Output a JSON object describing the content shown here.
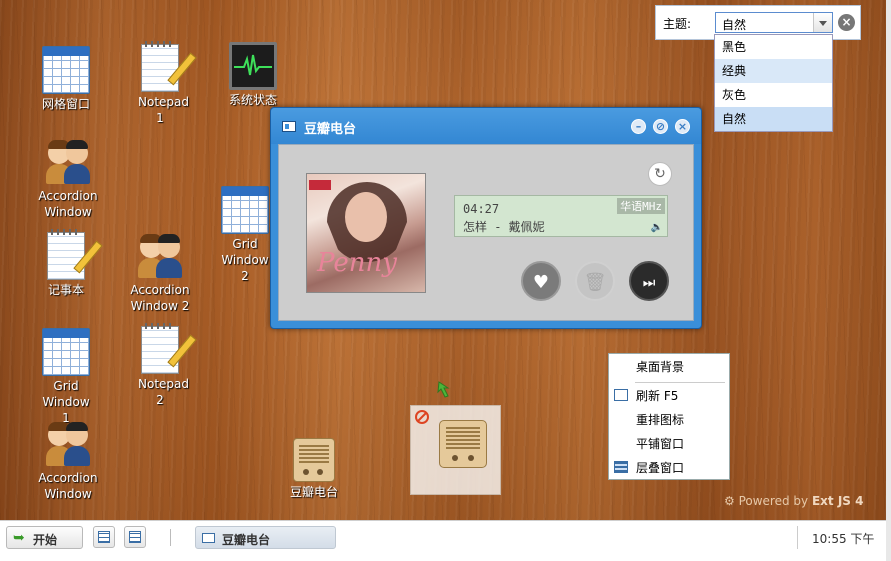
{
  "desktop": {
    "shortcuts": [
      {
        "id": "grid-window",
        "label": "网格窗口",
        "icon": "grid-icon"
      },
      {
        "id": "notepad-1",
        "label": "Notepad 1",
        "icon": "notepad-icon"
      },
      {
        "id": "system-status",
        "label": "系统状态",
        "icon": "monitor-icon"
      },
      {
        "id": "accordion-window",
        "label": "Accordion Window",
        "icon": "users-icon"
      },
      {
        "id": "grid-window-2",
        "label": "Grid Window 2",
        "icon": "grid-icon"
      },
      {
        "id": "notebook",
        "label": "记事本",
        "icon": "notepad-icon"
      },
      {
        "id": "accordion-window-2",
        "label": "Accordion Window 2",
        "icon": "users-icon"
      },
      {
        "id": "grid-window-1",
        "label": "Grid Window 1",
        "icon": "grid-icon"
      },
      {
        "id": "notepad-2",
        "label": "Notepad 2",
        "icon": "notepad-icon"
      },
      {
        "id": "accordion-window-3",
        "label": "Accordion Window",
        "icon": "users-icon"
      },
      {
        "id": "douban-radio",
        "label": "豆瓣电台",
        "icon": "radio-icon"
      }
    ],
    "powered_prefix": "Powered by",
    "powered_brand": "Ext JS 4"
  },
  "theme": {
    "label": "主题:",
    "selected": "自然",
    "options": [
      "黑色",
      "经典",
      "灰色",
      "自然"
    ]
  },
  "radio_window": {
    "title": "豆瓣电台",
    "time": "04:27",
    "song": "怎样 - 戴佩妮",
    "channel": "华语MHz",
    "cover_text": "Penny"
  },
  "context_menu": {
    "items": [
      "桌面背景",
      "刷新 F5",
      "重排图标",
      "平铺窗口",
      "层叠窗口"
    ]
  },
  "taskbar": {
    "start_label": "开始",
    "task_label": "豆瓣电台",
    "clock": "10:55 下午"
  },
  "colors": {
    "window_blue": "#3a8fd9",
    "lcd_green": "#d3e6d0",
    "selection": "#c9def5"
  }
}
